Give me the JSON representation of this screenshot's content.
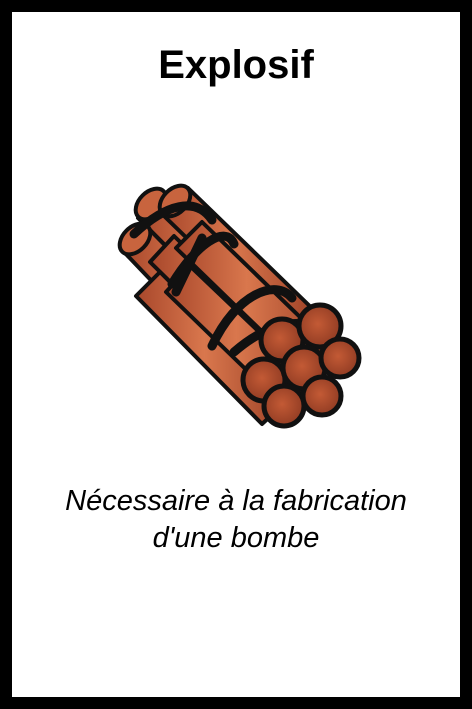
{
  "card": {
    "title": "Explosif",
    "description": "Nécessaire à la fabrication d'une bombe",
    "art_icon": "dynamite-bundle-icon"
  },
  "colors": {
    "background": "#000000",
    "card": "#ffffff",
    "stick": "#c8643e",
    "stick_shadow": "#a2442a",
    "tape": "#1b1b1b"
  }
}
